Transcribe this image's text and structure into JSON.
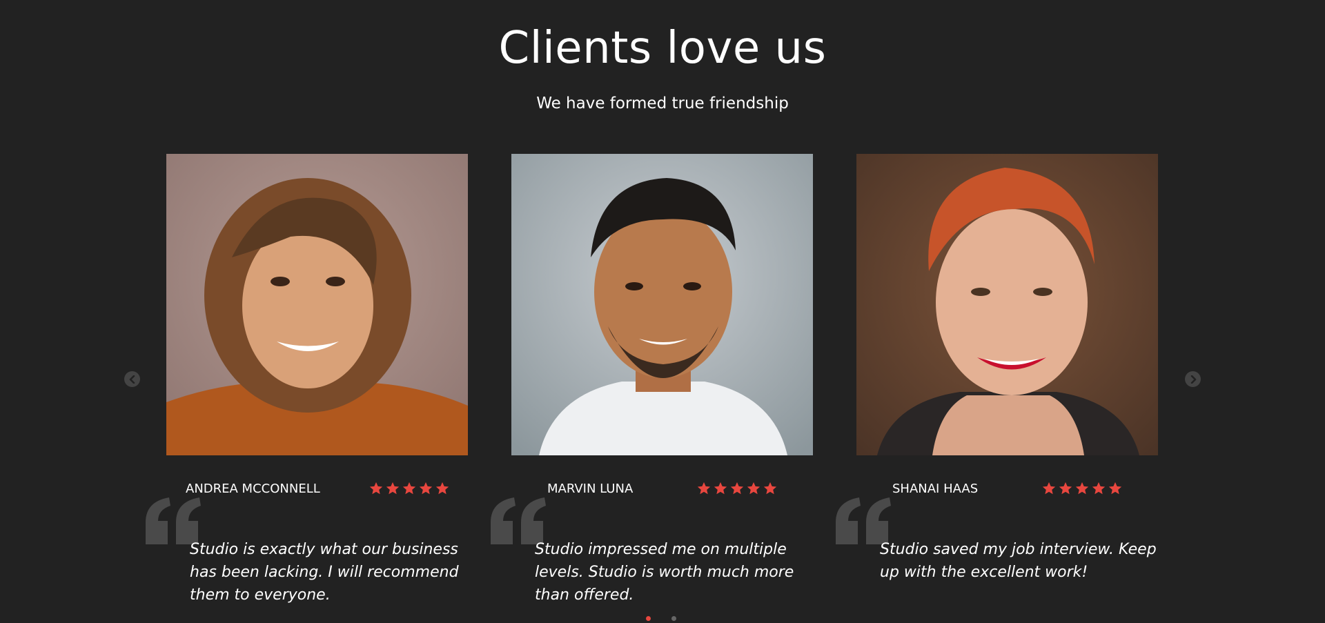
{
  "header": {
    "title": "Clients love us",
    "subtitle": "We have formed true friendship"
  },
  "colors": {
    "background": "#222222",
    "star": "#e8473f",
    "quote_mark": "#4a4a4a",
    "active_dot": "#e8473f"
  },
  "icons": {
    "prev": "chevron-left-icon",
    "next": "chevron-right-icon",
    "rating": "star-icon",
    "quote": "quote-icon"
  },
  "testimonials": [
    {
      "name": "ANDREA MCCONNELL",
      "rating": 5,
      "quote": "Studio is exactly what our business has been lacking. I will recommend them to everyone."
    },
    {
      "name": "MARVIN LUNA",
      "rating": 5,
      "quote": "Studio impressed me on multiple levels. Studio is worth much more than offered."
    },
    {
      "name": "SHANAI HAAS",
      "rating": 5,
      "quote": "Studio saved my job interview. Keep up with the excellent work!"
    }
  ],
  "pagination": {
    "pages": 2,
    "active": 1
  }
}
